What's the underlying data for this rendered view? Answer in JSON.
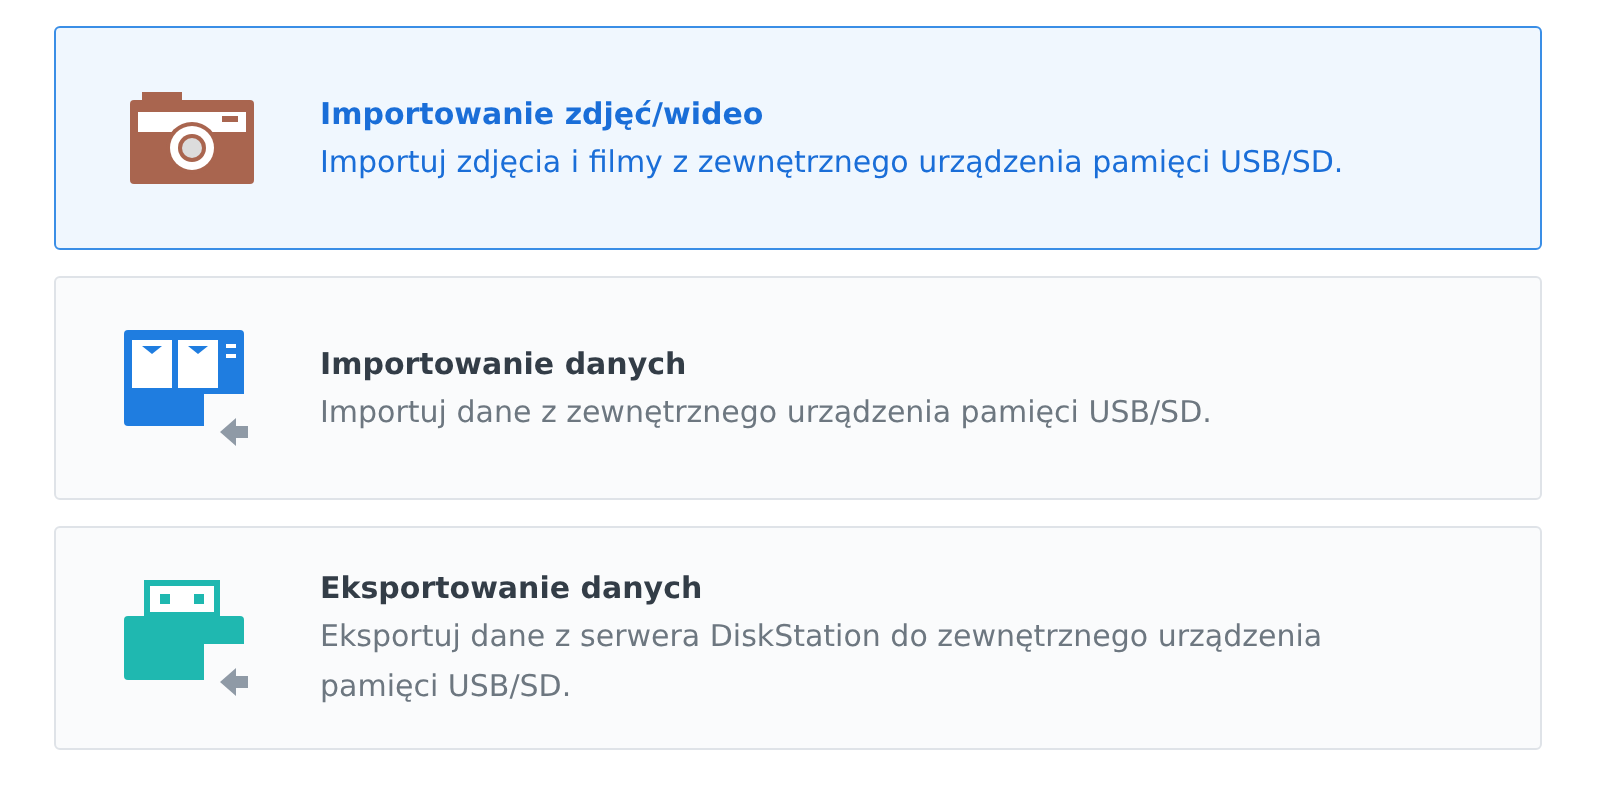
{
  "options": [
    {
      "kind": "camera",
      "selected": true,
      "title": "Importowanie zdjęć/wideo",
      "description": "Importuj zdjęcia i filmy z zewnętrznego urządzenia pamięci USB/SD."
    },
    {
      "kind": "storage",
      "selected": false,
      "title": "Importowanie danych",
      "description": "Importuj dane z zewnętrznego urządzenia pamięci USB/SD."
    },
    {
      "kind": "usb",
      "selected": false,
      "title": "Eksportowanie danych",
      "description": "Eksportuj dane z serwera DiskStation do zewnętrznego urządzenia pamięci USB/SD."
    }
  ]
}
